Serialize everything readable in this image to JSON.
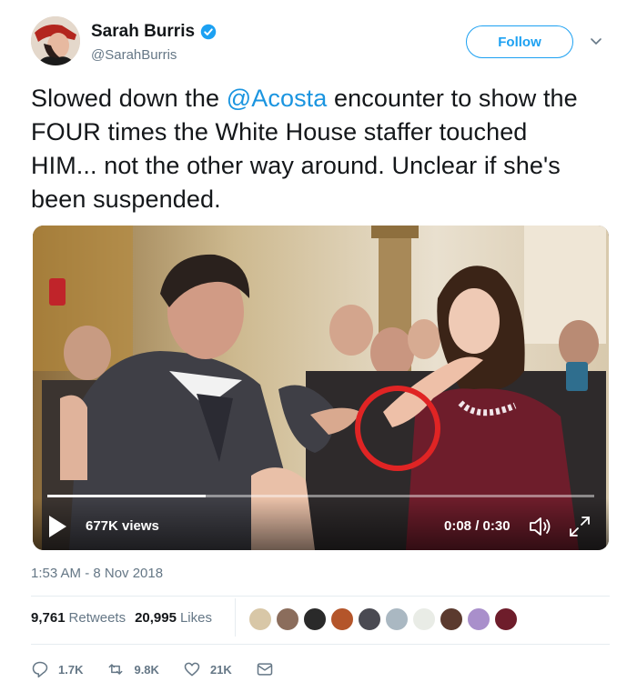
{
  "tweet": {
    "display_name": "Sarah Burris",
    "handle": "@SarahBurris",
    "follow_label": "Follow",
    "text_before": "Slowed down the ",
    "mention": "@Acosta",
    "text_after": " encounter to show the FOUR times the White House staffer touched HIM... not the other way around. Unclear if she's been suspended.",
    "timestamp": "1:53 AM - 8 Nov 2018"
  },
  "video": {
    "views": "677K views",
    "time": "0:08 / 0:30",
    "progress_fraction": 0.29
  },
  "stats": {
    "retweets_count": "9,761",
    "retweets_label": "Retweets",
    "likes_count": "20,995",
    "likes_label": "Likes"
  },
  "actions": {
    "replies": "1.7K",
    "retweets": "9.8K",
    "likes": "21K"
  },
  "icons": {
    "verified": "verified-badge-icon",
    "caret": "chevron-down-icon",
    "play": "play-icon",
    "volume": "volume-icon",
    "fullscreen": "fullscreen-icon",
    "reply": "reply-icon",
    "retweet": "retweet-icon",
    "like": "heart-icon",
    "message": "envelope-icon"
  },
  "colors": {
    "accent": "#1da1f2",
    "mention": "#1b95e0",
    "text": "#14171a",
    "muted": "#657786"
  }
}
